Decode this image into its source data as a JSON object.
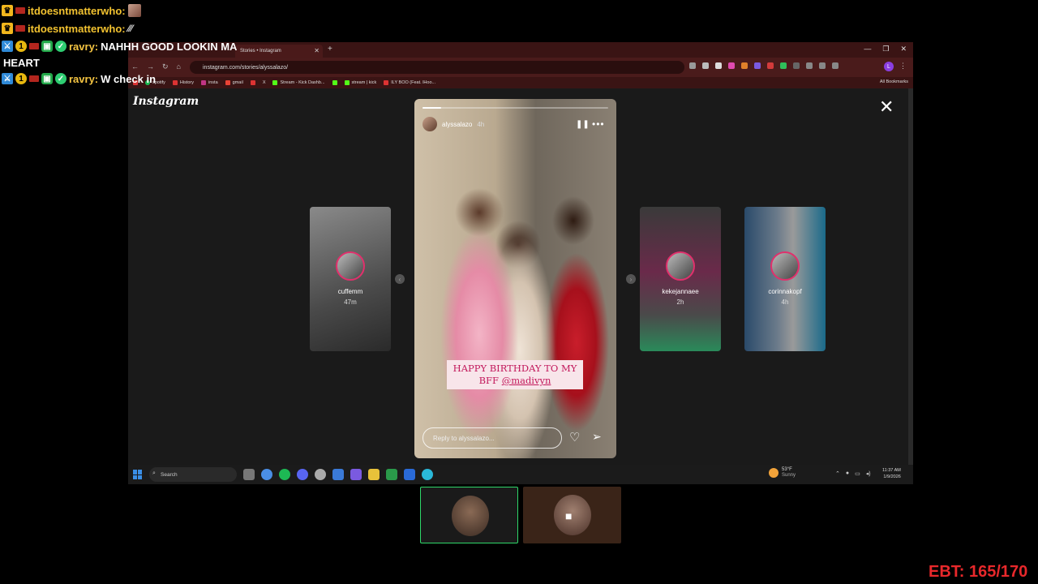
{
  "chat": {
    "messages": [
      {
        "user": "itdoesntmatterwho:",
        "text": ""
      },
      {
        "user": "itdoesntmatterwho:",
        "text": ""
      },
      {
        "user": "ravry:",
        "text": "NAHHH GOOD LOOKIN MA",
        "cont": "HEART"
      },
      {
        "user": "ravry:",
        "text": "W check in"
      }
    ]
  },
  "browser": {
    "tab_title": "Stories • Instagram",
    "url": "instagram.com/stories/alyssalazo/",
    "profile_letter": "L",
    "bookmarks": [
      "spotify",
      "History",
      "insta",
      "gmail",
      "X",
      "Stream - Kick Dashb...",
      "stream | kick",
      "ILY BOO (Feat. lHoo..."
    ],
    "all_bookmarks": "All Bookmarks"
  },
  "instagram": {
    "logo": "Instagram",
    "story": {
      "username": "alyssalazo",
      "time": "4h",
      "progress": 0.1,
      "caption_line1": "HAPPY BIRTHDAY TO MY",
      "caption_line2_prefix": "BFF ",
      "caption_mention": "@madivyn",
      "reply_placeholder": "Reply to alyssalazo..."
    },
    "thumbnails": [
      {
        "name": "cuffemm",
        "time": "47m"
      },
      {
        "name": "kekejannaee",
        "time": "2h"
      },
      {
        "name": "corinnakopf",
        "time": "4h"
      }
    ]
  },
  "taskbar": {
    "search_label": "Search",
    "weather_temp": "53°F",
    "weather_desc": "Sunny",
    "time": "11:37 AM",
    "date": "1/9/2026"
  },
  "overlay": {
    "ebt_label": "EBT: 165/170"
  }
}
